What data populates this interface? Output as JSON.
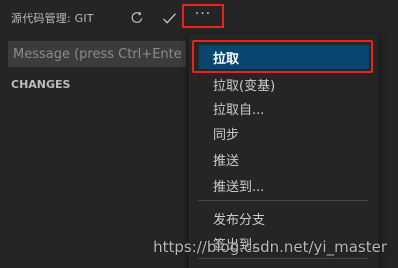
{
  "header": {
    "title": "源代码管理: GIT",
    "refresh_icon": "refresh-icon",
    "commit_icon": "check-icon",
    "more_label": "···"
  },
  "commit": {
    "placeholder": "Message (press Ctrl+Enter to"
  },
  "changes": {
    "label": "CHANGES"
  },
  "menu": {
    "items": [
      {
        "label": "拉取",
        "active": true
      },
      {
        "label": "拉取(变基)"
      },
      {
        "label": "拉取自..."
      },
      {
        "label": "同步"
      },
      {
        "label": "推送"
      },
      {
        "label": "推送到..."
      },
      {
        "label": "发布分支"
      },
      {
        "label": "签出到..."
      }
    ]
  },
  "watermark": "https://blog.csdn.net/yi_master",
  "colors": {
    "background": "#252526",
    "active_item": "#094771",
    "highlight": "#e8241d"
  }
}
